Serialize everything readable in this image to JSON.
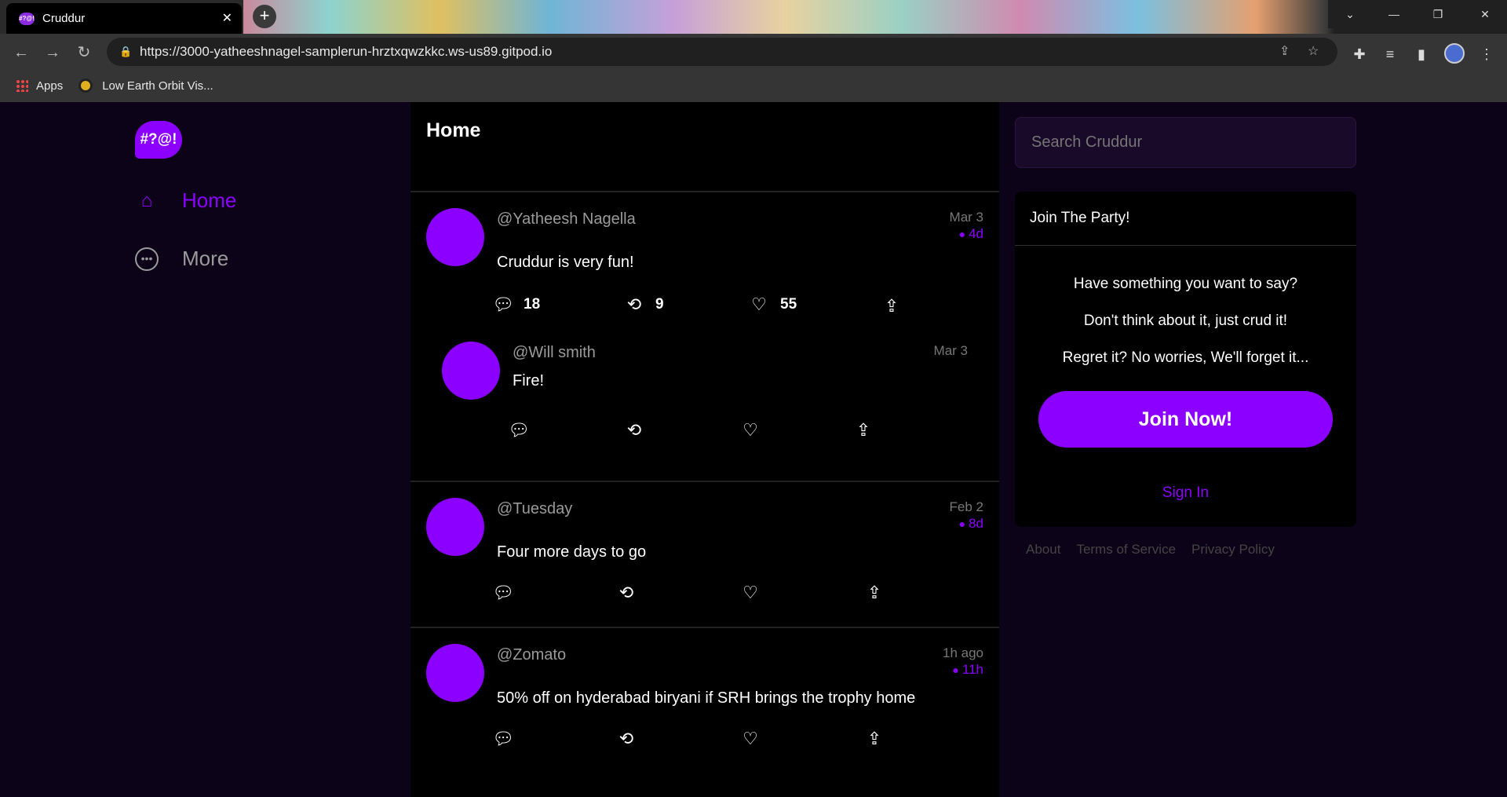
{
  "browser": {
    "tab_title": "Cruddur",
    "favicon_text": "#?@!",
    "tab_close": "✕",
    "new_tab": "+",
    "url": "https://3000-yatheeshnagel-samplerun-hrztxqwzkkc.ws-us89.gitpod.io",
    "bookmarks": [
      {
        "label": "Apps"
      },
      {
        "label": "Low Earth Orbit Vis..."
      }
    ]
  },
  "sidebar": {
    "logo_text": "#?@!",
    "items": [
      {
        "label": "Home",
        "icon": "home-icon"
      },
      {
        "label": "More",
        "icon": "more-icon"
      }
    ]
  },
  "feed": {
    "title": "Home",
    "posts": [
      {
        "handle": "@Yatheesh Nagella",
        "text": "Cruddur is very fun!",
        "date": "Mar 3",
        "ttl": "4d",
        "replies": "18",
        "reposts": "9",
        "likes": "55"
      },
      {
        "handle": "@Will smith",
        "text": "Fire!",
        "date": "Mar 3"
      },
      {
        "handle": "@Tuesday",
        "text": "Four more days to go",
        "date": "Feb 2",
        "ttl": "8d"
      },
      {
        "handle": "@Zomato",
        "text": "50% off on hyderabad biryani if SRH brings the trophy home",
        "date": "1h ago",
        "ttl": "11h"
      }
    ]
  },
  "search": {
    "placeholder": "Search Cruddur"
  },
  "join": {
    "title": "Join The Party!",
    "lines": [
      "Have something you want to say?",
      "Don't think about it, just crud it!",
      "Regret it? No worries, We'll forget it..."
    ],
    "button": "Join Now!",
    "signin": "Sign In"
  },
  "footer": {
    "links": [
      "About",
      "Terms of Service",
      "Privacy Policy"
    ]
  },
  "colors": {
    "accent": "#8b00ff",
    "feed_bg": "#000000",
    "page_bg": "#0d0319"
  }
}
